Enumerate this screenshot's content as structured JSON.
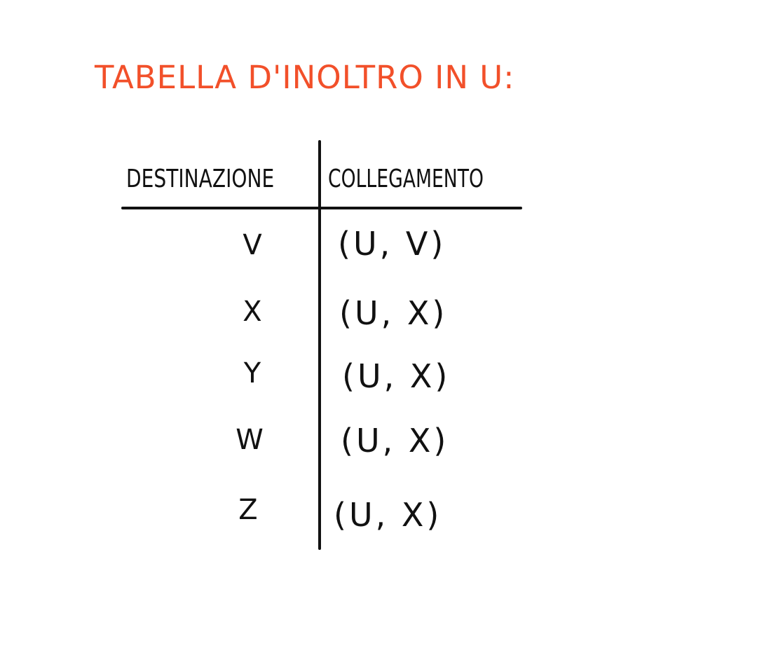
{
  "title": "TABELLA D'INOLTRO IN U:",
  "table": {
    "headers": [
      "DESTINAZIONE",
      "COLLEGAMENTO"
    ],
    "rows": [
      {
        "destinazione": "V",
        "collegamento": "(U, V)"
      },
      {
        "destinazione": "X",
        "collegamento": "(U, X)"
      },
      {
        "destinazione": "Y",
        "collegamento": "(U, X)"
      },
      {
        "destinazione": "W",
        "collegamento": "(U, X)"
      },
      {
        "destinazione": "Z",
        "collegamento": "(U, X)"
      }
    ]
  },
  "colors": {
    "title": "#f2502a",
    "ink": "#111111",
    "background": "#ffffff"
  }
}
